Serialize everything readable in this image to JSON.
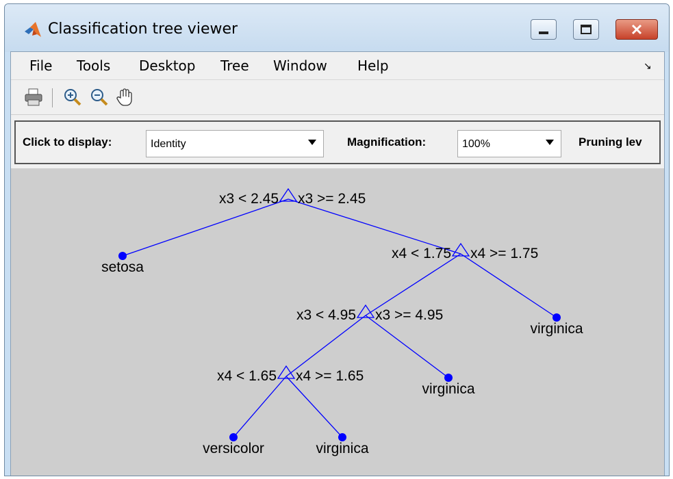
{
  "window": {
    "title": "Classification tree viewer"
  },
  "menu": {
    "items": [
      "File",
      "Tools",
      "Desktop",
      "Tree",
      "Window",
      "Help"
    ]
  },
  "toolbar": {
    "icons": [
      "print-icon",
      "zoom-in-icon",
      "zoom-out-icon",
      "pan-hand-icon"
    ]
  },
  "controls": {
    "display_label": "Click to display:",
    "display_value": "Identity",
    "magnification_label": "Magnification:",
    "magnification_value": "100%",
    "pruning_label": "Pruning lev"
  },
  "tree": {
    "splits": [
      {
        "left": "x3 < 2.45",
        "right": "x3 >= 2.45"
      },
      {
        "left": "x4 < 1.75",
        "right": "x4 >= 1.75"
      },
      {
        "left": "x3 < 4.95",
        "right": "x3 >= 4.95"
      },
      {
        "left": "x4 < 1.65",
        "right": "x4 >= 1.65"
      }
    ],
    "leaves": [
      "setosa",
      "virginica",
      "virginica",
      "versicolor",
      "virginica"
    ]
  },
  "colors": {
    "tree": "#0000ff",
    "background": "#cecece"
  }
}
